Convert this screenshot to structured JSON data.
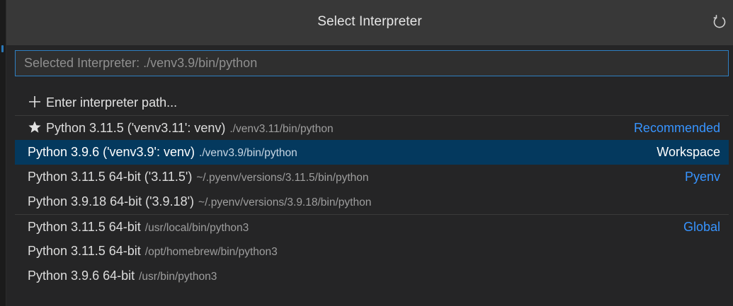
{
  "picker": {
    "title": "Select Interpreter",
    "refresh_icon": "refresh-icon",
    "search": {
      "value": "",
      "placeholder": "Selected Interpreter: ./venv3.9/bin/python"
    },
    "enter_path": {
      "icon": "plus-icon",
      "label": "Enter interpreter path..."
    },
    "items": [
      {
        "icon": "star-icon",
        "label": "Python 3.11.5 ('venv3.11': venv)",
        "description": "./venv3.11/bin/python",
        "tag": "Recommended",
        "selected": false
      },
      {
        "label": "Python 3.9.6 ('venv3.9': venv)",
        "description": "./venv3.9/bin/python",
        "tag": "Workspace",
        "selected": true
      },
      {
        "label": "Python 3.11.5 64-bit ('3.11.5')",
        "description": "~/.pyenv/versions/3.11.5/bin/python",
        "tag": "Pyenv",
        "selected": false
      },
      {
        "label": "Python 3.9.18 64-bit ('3.9.18')",
        "description": "~/.pyenv/versions/3.9.18/bin/python",
        "tag": "",
        "selected": false
      },
      {
        "label": "Python 3.11.5 64-bit",
        "description": "/usr/local/bin/python3",
        "tag": "Global",
        "selected": false
      },
      {
        "label": "Python 3.11.5 64-bit",
        "description": "/opt/homebrew/bin/python3",
        "tag": "",
        "selected": false
      },
      {
        "label": "Python 3.9.6 64-bit",
        "description": "/usr/bin/python3",
        "tag": "",
        "selected": false
      }
    ]
  },
  "colors": {
    "accent": "#3794ff",
    "selection": "#04395e",
    "focus_border": "#2f7fc2"
  }
}
